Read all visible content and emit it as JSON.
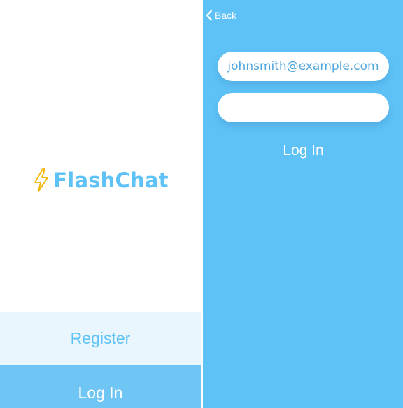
{
  "colors": {
    "brand_blue": "#5ec2f7",
    "bolt_yellow": "#f5b400",
    "register_bg": "#eaf6fd",
    "login_button_bg": "#6fc6f5",
    "login_screen_bg": "#5ec2f7",
    "field_text": "#4fa6dc"
  },
  "welcome": {
    "logo": {
      "icon": "lightning-bolt-icon",
      "brand_name": "FlashChat"
    },
    "register_button": {
      "label": "Register"
    },
    "login_button": {
      "label": "Log In"
    }
  },
  "login": {
    "back_button": {
      "icon": "chevron-left-icon",
      "label": "Back"
    },
    "email_field": {
      "value": "johnsmith@example.com",
      "placeholder": ""
    },
    "password_field": {
      "value": "",
      "placeholder": ""
    },
    "login_button": {
      "label": "Log In"
    }
  }
}
